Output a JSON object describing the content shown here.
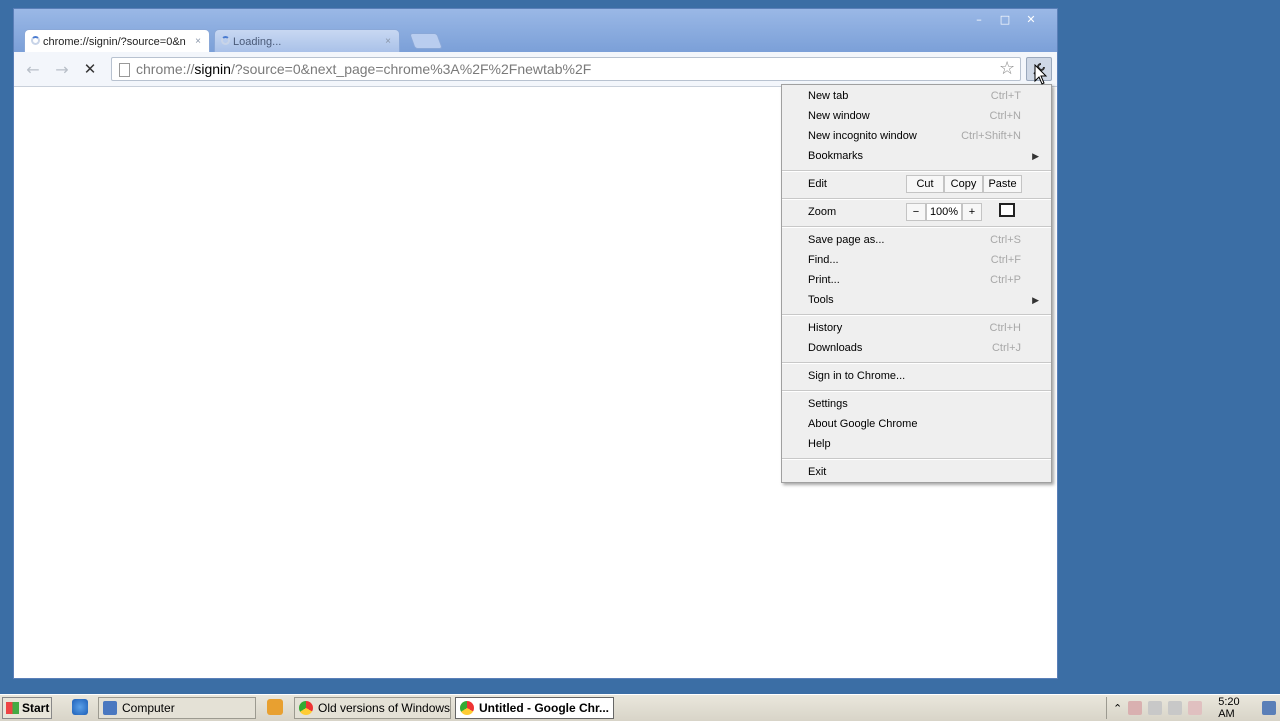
{
  "tabs": [
    {
      "title": "chrome://signin/?source=0&n",
      "close": "×"
    },
    {
      "title": "Loading...",
      "close": "×"
    }
  ],
  "window_controls": {
    "minimize": "–",
    "maximize": "□",
    "close": "✕"
  },
  "toolbar": {
    "back": "←",
    "forward": "→",
    "stop": "✕",
    "url_scheme": "chrome://",
    "url_host": "signin",
    "url_rest": "/?source=0&next_page=chrome%3A%2F%2Fnewtab%2F",
    "star": "☆",
    "wrench": "🔧"
  },
  "menu": {
    "new_tab": {
      "label": "New tab",
      "shortcut": "Ctrl+T"
    },
    "new_window": {
      "label": "New window",
      "shortcut": "Ctrl+N"
    },
    "new_incognito": {
      "label": "New incognito window",
      "shortcut": "Ctrl+Shift+N"
    },
    "bookmarks": {
      "label": "Bookmarks",
      "arrow": "▶"
    },
    "edit": {
      "label": "Edit",
      "cut": "Cut",
      "copy": "Copy",
      "paste": "Paste"
    },
    "zoom": {
      "label": "Zoom",
      "minus": "−",
      "value": "100%",
      "plus": "+"
    },
    "save_page": {
      "label": "Save page as...",
      "shortcut": "Ctrl+S"
    },
    "find": {
      "label": "Find...",
      "shortcut": "Ctrl+F"
    },
    "print": {
      "label": "Print...",
      "shortcut": "Ctrl+P"
    },
    "tools": {
      "label": "Tools",
      "arrow": "▶"
    },
    "history": {
      "label": "History",
      "shortcut": "Ctrl+H"
    },
    "downloads": {
      "label": "Downloads",
      "shortcut": "Ctrl+J"
    },
    "sign_in": {
      "label": "Sign in to Chrome..."
    },
    "settings": {
      "label": "Settings"
    },
    "about": {
      "label": "About Google Chrome"
    },
    "help": {
      "label": "Help"
    },
    "exit": {
      "label": "Exit"
    }
  },
  "taskbar": {
    "start": "Start",
    "items": [
      {
        "label": "Computer"
      },
      {
        "label": "Old versions of Windows..."
      },
      {
        "label": "Untitled - Google Chr..."
      }
    ],
    "clock": "5:20 AM",
    "tray_expand": "⌃"
  }
}
